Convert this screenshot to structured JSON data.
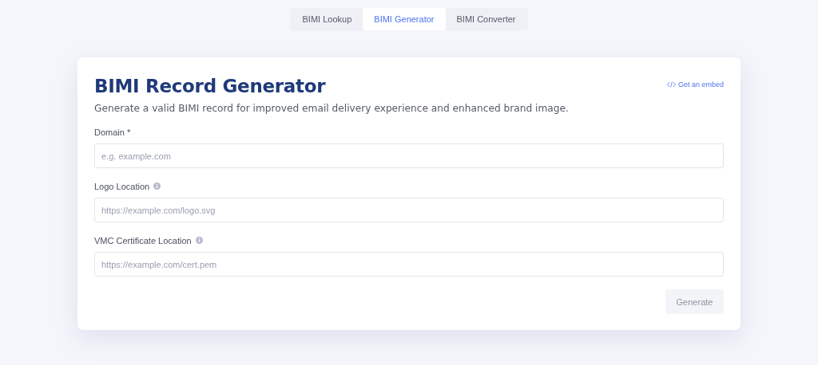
{
  "tabs": [
    {
      "label": "BIMI Lookup",
      "selected": false
    },
    {
      "label": "BIMI Generator",
      "selected": true
    },
    {
      "label": "BIMI Converter",
      "selected": false
    }
  ],
  "card": {
    "title": "BIMI Record Generator",
    "embed_link": "Get an embed",
    "subtitle": "Generate a valid BIMI record for improved email delivery experience and enhanced brand image.",
    "fields": [
      {
        "label": "Domain *",
        "info": false,
        "placeholder": "e.g. example.com"
      },
      {
        "label": "Logo Location",
        "info": true,
        "placeholder": "https://example.com/logo.svg"
      },
      {
        "label": "VMC Certificate Location",
        "info": true,
        "placeholder": "https://example.com/cert.pem"
      }
    ],
    "button": {
      "label": "Generate",
      "disabled": true
    }
  }
}
